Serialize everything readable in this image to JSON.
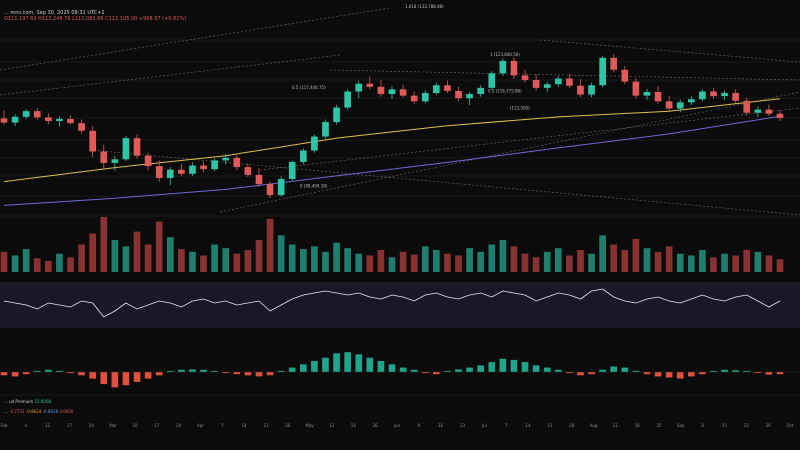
{
  "header": {
    "symbol_line": "... mns.com, Sep 30, 2025 09:31 UTC+1",
    "ohlc": "O111,197.63   H113,248.76   L111,083.86   C112,105.00   +908.37 (+0.81%)"
  },
  "fib_labels": [
    {
      "text": "1 (123,840.56)",
      "price": 123840
    },
    {
      "text": "0.5 (117,446.75)",
      "price": 117446
    },
    {
      "text": "0.5 (116,775.88)",
      "price": 116775
    },
    {
      "text": "(113,500)",
      "price": 113500
    },
    {
      "text": "0 (98,499.38)",
      "price": 98499
    },
    {
      "text": "1.618 (133,788.88)",
      "price": 133788
    }
  ],
  "indicator_legend": {
    "label": "... ud Premium",
    "value": "15.6008"
  },
  "macd_legend": {
    "label": "...",
    "v1": "-0.7751",
    "v2": "-0.8624",
    "v3": "-0.8628",
    "v4": "0.0000"
  },
  "chart_data": {
    "type": "candlestick",
    "price_range": [
      92000,
      131000
    ],
    "candles": [
      [
        0,
        112000,
        113500,
        110800,
        111200
      ],
      [
        1,
        111200,
        112800,
        110500,
        112300
      ],
      [
        2,
        112300,
        113800,
        111900,
        113400
      ],
      [
        3,
        113400,
        114000,
        111800,
        112200
      ],
      [
        4,
        112200,
        113000,
        110900,
        111500
      ],
      [
        5,
        111500,
        112400,
        110400,
        111900
      ],
      [
        6,
        111900,
        112600,
        110800,
        111100
      ],
      [
        7,
        111100,
        111800,
        109000,
        109600
      ],
      [
        8,
        109600,
        110500,
        104500,
        105600
      ],
      [
        9,
        105600,
        106900,
        102300,
        103400
      ],
      [
        10,
        103400,
        104800,
        101900,
        104100
      ],
      [
        11,
        104100,
        108600,
        103800,
        108200
      ],
      [
        12,
        108200,
        108900,
        104200,
        104800
      ],
      [
        13,
        104800,
        105400,
        102000,
        102800
      ],
      [
        14,
        102800,
        103900,
        99800,
        100500
      ],
      [
        15,
        100500,
        102600,
        99100,
        102100
      ],
      [
        16,
        102100,
        103200,
        100800,
        101300
      ],
      [
        17,
        101300,
        103500,
        100900,
        102900
      ],
      [
        18,
        102900,
        103700,
        101600,
        102200
      ],
      [
        19,
        102200,
        104300,
        101800,
        103900
      ],
      [
        20,
        103900,
        105100,
        103100,
        104400
      ],
      [
        21,
        104400,
        104900,
        102000,
        102600
      ],
      [
        22,
        102600,
        103300,
        100700,
        101100
      ],
      [
        23,
        101100,
        102400,
        98800,
        99300
      ],
      [
        24,
        99300,
        99800,
        96600,
        97200
      ],
      [
        25,
        97200,
        100800,
        96900,
        100300
      ],
      [
        26,
        100300,
        103900,
        100000,
        103600
      ],
      [
        27,
        103600,
        106200,
        103100,
        105800
      ],
      [
        28,
        105800,
        108900,
        105400,
        108500
      ],
      [
        29,
        108500,
        111800,
        108100,
        111300
      ],
      [
        30,
        111300,
        114600,
        110800,
        114100
      ],
      [
        31,
        114100,
        117600,
        113700,
        117200
      ],
      [
        32,
        117200,
        119300,
        115900,
        118700
      ],
      [
        33,
        118700,
        120100,
        117600,
        118100
      ],
      [
        34,
        118100,
        119400,
        116200,
        116700
      ],
      [
        35,
        116700,
        118200,
        115800,
        117600
      ],
      [
        36,
        117600,
        118500,
        116100,
        116400
      ],
      [
        37,
        116400,
        117200,
        114800,
        115300
      ],
      [
        38,
        115300,
        117400,
        114900,
        116900
      ],
      [
        39,
        116900,
        118900,
        116500,
        118400
      ],
      [
        40,
        118400,
        119300,
        116900,
        117300
      ],
      [
        41,
        117300,
        118100,
        115300,
        115900
      ],
      [
        42,
        115900,
        117100,
        114600,
        116700
      ],
      [
        43,
        116700,
        118400,
        116200,
        117900
      ],
      [
        44,
        117900,
        121100,
        117500,
        120700
      ],
      [
        45,
        120700,
        123600,
        120200,
        123100
      ],
      [
        46,
        123100,
        123800,
        119600,
        120300
      ],
      [
        47,
        120300,
        121400,
        118900,
        119400
      ],
      [
        48,
        119400,
        120500,
        117400,
        117900
      ],
      [
        49,
        117900,
        119100,
        117100,
        118600
      ],
      [
        50,
        118600,
        120200,
        118100,
        119700
      ],
      [
        51,
        119700,
        120600,
        117900,
        118300
      ],
      [
        52,
        118300,
        119600,
        116100,
        116600
      ],
      [
        53,
        116600,
        118900,
        116100,
        118400
      ],
      [
        54,
        118400,
        124100,
        118000,
        123700
      ],
      [
        55,
        123700,
        124400,
        120900,
        121400
      ],
      [
        56,
        121400,
        122100,
        118600,
        119100
      ],
      [
        57,
        119100,
        119800,
        115900,
        116400
      ],
      [
        58,
        116400,
        117700,
        115600,
        117100
      ],
      [
        59,
        117100,
        118200,
        114800,
        115300
      ],
      [
        60,
        115300,
        116400,
        113400,
        113900
      ],
      [
        61,
        113900,
        115600,
        113200,
        115100
      ],
      [
        62,
        115100,
        116300,
        114600,
        115700
      ],
      [
        63,
        115700,
        117600,
        115300,
        117200
      ],
      [
        64,
        117200,
        117900,
        115800,
        116300
      ],
      [
        65,
        116300,
        117400,
        115600,
        116900
      ],
      [
        66,
        116900,
        117600,
        114900,
        115400
      ],
      [
        67,
        115400,
        116000,
        112600,
        113100
      ],
      [
        68,
        113100,
        114300,
        112300,
        113700
      ],
      [
        69,
        113700,
        114700,
        112500,
        112900
      ],
      [
        70,
        112900,
        113600,
        111500,
        112100
      ]
    ],
    "sma_yellow": [
      [
        0,
        99800
      ],
      [
        10,
        102500
      ],
      [
        20,
        104800
      ],
      [
        30,
        108200
      ],
      [
        40,
        110600
      ],
      [
        50,
        112300
      ],
      [
        60,
        113400
      ],
      [
        70,
        115800
      ]
    ],
    "sma_blue": [
      [
        0,
        95200
      ],
      [
        10,
        96600
      ],
      [
        20,
        98300
      ],
      [
        30,
        100900
      ],
      [
        40,
        103500
      ],
      [
        50,
        106300
      ],
      [
        60,
        109000
      ],
      [
        70,
        112400
      ]
    ],
    "volume": [
      22,
      18,
      25,
      15,
      12,
      20,
      16,
      30,
      42,
      60,
      35,
      28,
      44,
      30,
      55,
      38,
      25,
      22,
      18,
      30,
      26,
      20,
      24,
      35,
      58,
      40,
      30,
      25,
      28,
      22,
      32,
      26,
      20,
      18,
      24,
      16,
      22,
      19,
      28,
      24,
      20,
      18,
      26,
      22,
      30,
      35,
      28,
      20,
      16,
      22,
      26,
      18,
      24,
      20,
      40,
      30,
      24,
      36,
      26,
      22,
      28,
      20,
      18,
      24,
      16,
      20,
      18,
      24,
      22,
      18,
      14
    ],
    "oscillator": [
      0.2,
      0.1,
      0.0,
      -0.2,
      0.1,
      0.0,
      -0.1,
      0.2,
      0.1,
      -0.6,
      -0.3,
      0.1,
      -0.2,
      0.0,
      0.2,
      0.1,
      -0.1,
      0.2,
      0.3,
      0.1,
      0.2,
      0.0,
      0.1,
      0.2,
      -0.3,
      0.0,
      0.3,
      0.5,
      0.6,
      0.7,
      0.6,
      0.5,
      0.6,
      0.4,
      0.3,
      0.5,
      0.4,
      0.2,
      0.5,
      0.6,
      0.4,
      0.3,
      0.5,
      0.6,
      0.4,
      0.7,
      0.6,
      0.5,
      0.2,
      0.4,
      0.6,
      0.5,
      0.3,
      0.7,
      0.8,
      0.4,
      0.2,
      0.1,
      0.3,
      0.4,
      0.2,
      0.1,
      0.3,
      0.5,
      0.3,
      0.2,
      0.4,
      0.5,
      0.2,
      -0.1,
      0.2
    ],
    "macd_hist": [
      -0.15,
      -0.2,
      -0.1,
      0.05,
      0.1,
      0.05,
      -0.05,
      -0.15,
      -0.3,
      -0.55,
      -0.7,
      -0.6,
      -0.45,
      -0.3,
      -0.15,
      0.05,
      0.1,
      0.12,
      0.1,
      0.05,
      -0.05,
      -0.1,
      -0.15,
      -0.2,
      -0.15,
      0.05,
      0.2,
      0.35,
      0.5,
      0.65,
      0.85,
      0.9,
      0.8,
      0.65,
      0.5,
      0.35,
      0.2,
      0.1,
      -0.05,
      -0.1,
      0.05,
      0.12,
      0.2,
      0.3,
      0.45,
      0.6,
      0.55,
      0.45,
      0.3,
      0.2,
      0.1,
      -0.05,
      -0.15,
      -0.1,
      0.1,
      0.25,
      0.2,
      0.05,
      -0.1,
      -0.2,
      -0.25,
      -0.3,
      -0.2,
      -0.1,
      0.05,
      0.1,
      0.08,
      0.05,
      -0.05,
      -0.12,
      -0.1
    ],
    "x_ticks": [
      "Feb",
      "4",
      "11",
      "17",
      "24",
      "Mar",
      "10",
      "17",
      "24",
      "Apr",
      "7",
      "14",
      "21",
      "28",
      "May",
      "12",
      "19",
      "26",
      "Jun",
      "9",
      "16",
      "23",
      "Jul",
      "7",
      "14",
      "21",
      "28",
      "Aug",
      "11",
      "18",
      "25",
      "Sep",
      "8",
      "15",
      "22",
      "29",
      "Oct"
    ]
  }
}
